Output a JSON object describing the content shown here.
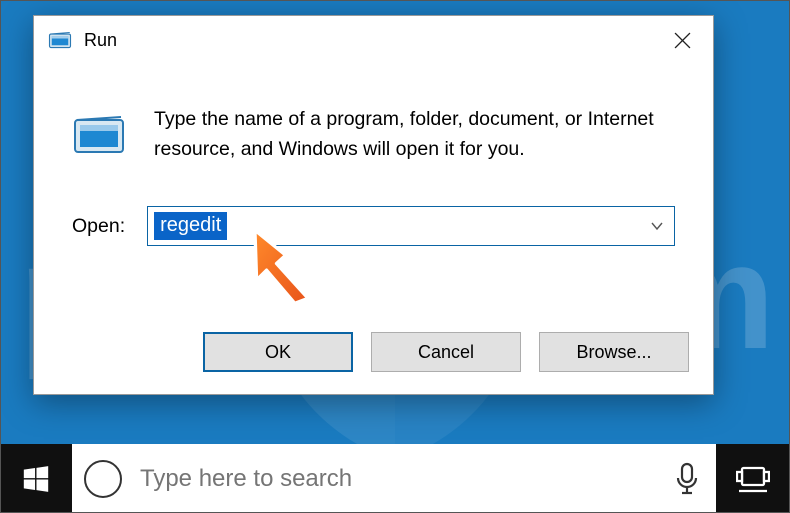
{
  "dialog": {
    "title": "Run",
    "message": "Type the name of a program, folder, document, or Internet resource, and Windows will open it for you.",
    "open_label": "Open:",
    "input_value": "regedit",
    "buttons": {
      "ok": "OK",
      "cancel": "Cancel",
      "browse": "Browse..."
    }
  },
  "taskbar": {
    "search_placeholder": "Type here to search"
  }
}
